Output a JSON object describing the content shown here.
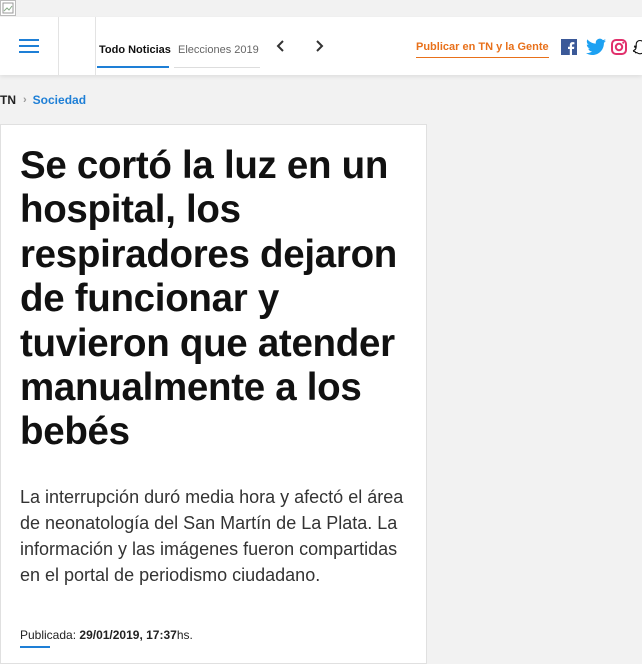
{
  "header": {
    "tabs": [
      {
        "label": "Todo Noticias",
        "active": true
      },
      {
        "label": "Elecciones 2019",
        "active": false
      }
    ],
    "publish_label": "Publicar en TN y la Gente",
    "social": [
      "facebook-icon",
      "twitter-icon",
      "instagram-icon",
      "snapchat-icon"
    ]
  },
  "breadcrumb": {
    "home": "TN",
    "section": "Sociedad"
  },
  "article": {
    "headline": "Se cortó la luz en un hospital, los respiradores dejaron de funcionar y tuvieron que atender manualmente a los bebés",
    "lede": "La interrupción duró media hora y afectó el área de neonatología del San Martín de La Plata. La información y las imágenes fueron compartidas en el portal de periodismo ciudadano.",
    "published_label": "Publicada:",
    "published_date": "29/01/2019, 17:37",
    "published_suffix": "hs."
  },
  "colors": {
    "accent_blue": "#1e7fd6",
    "publish_orange": "#e8701a",
    "facebook": "#3b5998",
    "twitter": "#1da1f2",
    "instagram": "#e1306c"
  }
}
